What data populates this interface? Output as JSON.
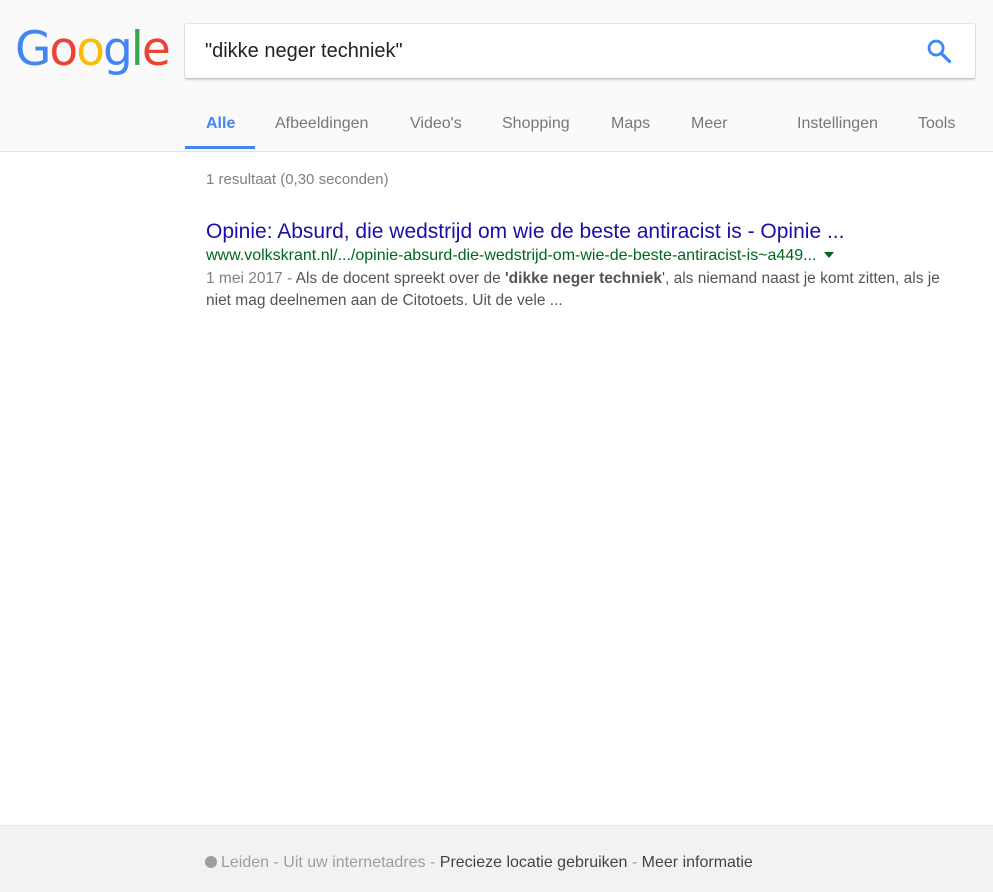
{
  "logo": {
    "letters": [
      "G",
      "o",
      "o",
      "g",
      "l",
      "e"
    ],
    "colors": [
      "#4285F4",
      "#EA4335",
      "#FBBC05",
      "#4285F4",
      "#34A853",
      "#EA4335"
    ]
  },
  "search": {
    "query": "\"dikke neger techniek\"",
    "icon": "search-icon"
  },
  "tabs": {
    "items": [
      "Alle",
      "Afbeeldingen",
      "Video's",
      "Shopping",
      "Maps",
      "Meer"
    ],
    "active": "Alle",
    "right": [
      "Instellingen",
      "Tools"
    ]
  },
  "stats": "1 resultaat (0,30 seconden)",
  "result": {
    "title": "Opinie: Absurd, die wedstrijd om wie de beste antiracist is - Opinie ...",
    "url": "www.volkskrant.nl/.../opinie-absurd-die-wedstrijd-om-wie-de-beste-antiracist-is~a449...",
    "date": "1 mei 2017",
    "snippet_pre": "Als de docent spreekt over de ",
    "snippet_bold": "'dikke neger techniek",
    "snippet_post": "', als niemand naast je komt zitten, als je niet mag deelnemen aan de Citotoets. Uit de vele ..."
  },
  "footer": {
    "location": "Leiden",
    "source": "Uit uw internetadres",
    "precise": "Precieze locatie gebruiken",
    "more": "Meer informatie"
  },
  "colors": {
    "link": "#1a0dab",
    "url": "#006621",
    "accent": "#4285f4"
  }
}
